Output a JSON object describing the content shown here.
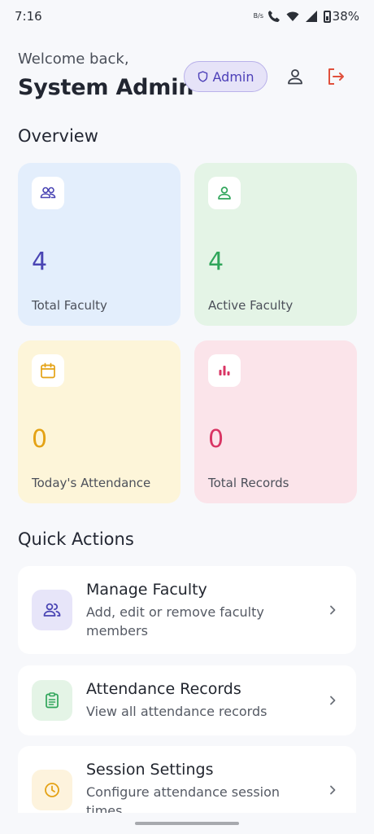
{
  "status_bar": {
    "time": "7:16",
    "network_label": "B/s",
    "battery": "38%"
  },
  "header": {
    "welcome": "Welcome back,",
    "name": "System Admin",
    "badge": "Admin"
  },
  "overview": {
    "title": "Overview",
    "stats": [
      {
        "value": "4",
        "label": "Total Faculty",
        "bg": "#e3eefc",
        "color": "#4a45b4"
      },
      {
        "value": "4",
        "label": "Active Faculty",
        "bg": "#e4f4e6",
        "color": "#2fa55a"
      },
      {
        "value": "0",
        "label": "Today's Attendance",
        "bg": "#fdf5d9",
        "color": "#e4a215"
      },
      {
        "value": "0",
        "label": "Total Records",
        "bg": "#fbe4ea",
        "color": "#d93564"
      }
    ]
  },
  "quick_actions": {
    "title": "Quick Actions",
    "items": [
      {
        "title": "Manage Faculty",
        "desc": "Add, edit or remove faculty members"
      },
      {
        "title": "Attendance Records",
        "desc": "View all attendance records"
      },
      {
        "title": "Session Settings",
        "desc": "Configure attendance session times"
      }
    ]
  },
  "icons": {
    "faculty": "users-icon",
    "active": "user-icon",
    "attendance": "calendar-icon",
    "records": "bar-chart-icon",
    "manage": "users-icon",
    "records_action": "clipboard-icon",
    "session": "clock-icon"
  }
}
